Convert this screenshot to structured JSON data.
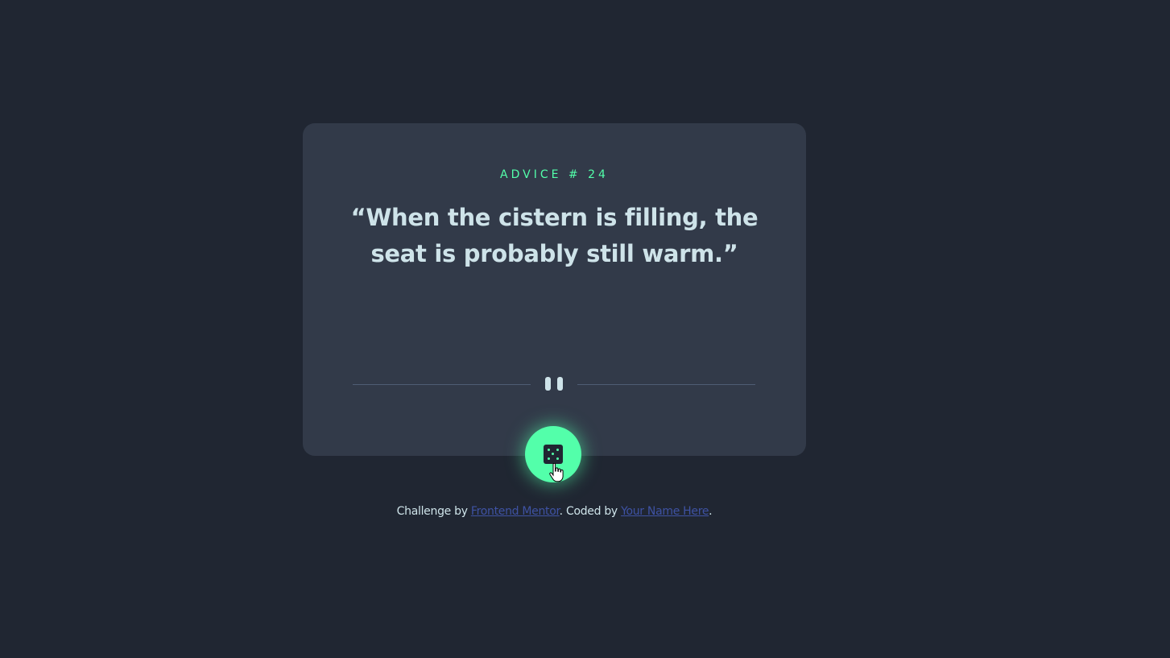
{
  "card": {
    "advice_label": "ADVICE # 24",
    "advice_text": "“When the cistern is filling, the seat is probably still warm.”"
  },
  "dice_button": {
    "icon": "dice-icon",
    "accent_color": "#53ffaa"
  },
  "footer": {
    "prefix": "Challenge by ",
    "link1": "Frontend Mentor",
    "middle": ". Coded by ",
    "link2": "Your Name Here",
    "suffix": "."
  },
  "colors": {
    "background": "#202632",
    "card": "#323a49",
    "accent": "#53ffaa",
    "text": "#cee3e9",
    "link": "#3e52a3"
  }
}
